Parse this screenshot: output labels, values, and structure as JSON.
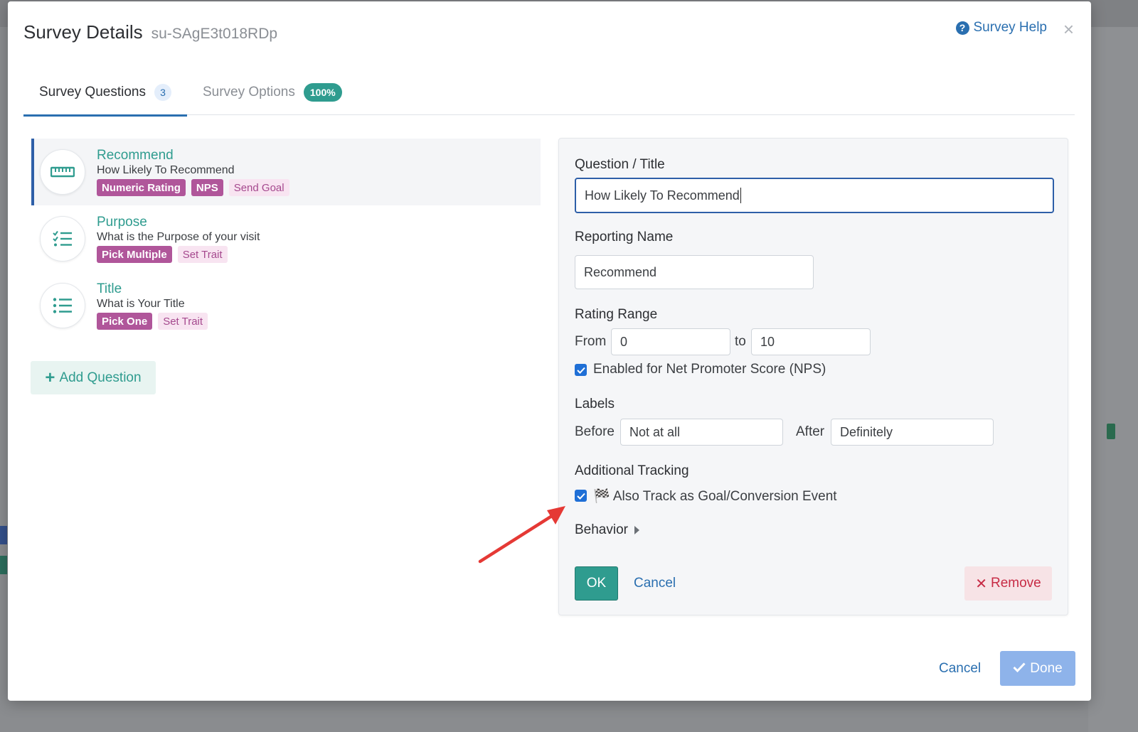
{
  "modal": {
    "title": "Survey Details",
    "survey_id": "su-SAgE3t018RDp",
    "help_label": "Survey Help",
    "help_icon": "question-circle-icon",
    "close_icon": "close-icon"
  },
  "tabs": [
    {
      "label": "Survey Questions",
      "badge": "3"
    },
    {
      "label": "Survey Options",
      "badge": "100%"
    }
  ],
  "questions": [
    {
      "name": "Recommend",
      "description": "How Likely To Recommend",
      "icon": "ruler-icon",
      "tags": [
        "Numeric Rating",
        "NPS",
        "Send Goal"
      ]
    },
    {
      "name": "Purpose",
      "description": "What is the Purpose of your visit",
      "icon": "checklist-icon",
      "tags": [
        "Pick Multiple",
        "Set Trait"
      ]
    },
    {
      "name": "Title",
      "description": "What is Your Title",
      "icon": "list-icon",
      "tags": [
        "Pick One",
        "Set Trait"
      ]
    }
  ],
  "add_question_label": "Add Question",
  "editor": {
    "question_title_label": "Question / Title",
    "question_title_value": "How Likely To Recommend",
    "reporting_name_label": "Reporting Name",
    "reporting_name_value": "Recommend",
    "rating_range_label": "Rating Range",
    "from_label": "From",
    "from_value": "0",
    "to_label": "to",
    "to_value": "10",
    "nps_checkbox_label": "Enabled for Net Promoter Score (NPS)",
    "labels_label": "Labels",
    "before_label": "Before",
    "before_value": "Not at all",
    "after_label": "After",
    "after_value": "Definitely",
    "additional_tracking_label": "Additional Tracking",
    "goal_checkbox_label": "🏁 Also Track as Goal/Conversion Event",
    "behavior_label": "Behavior",
    "ok_label": "OK",
    "cancel_label": "Cancel",
    "remove_label": "Remove"
  },
  "footer": {
    "cancel_label": "Cancel",
    "done_label": "Done"
  },
  "colors": {
    "teal": "#2f9c8f",
    "link_blue": "#2a6fb0",
    "tag_purple": "#b0569a",
    "remove_red": "#c72b45",
    "annotation_arrow": "#e53935"
  }
}
